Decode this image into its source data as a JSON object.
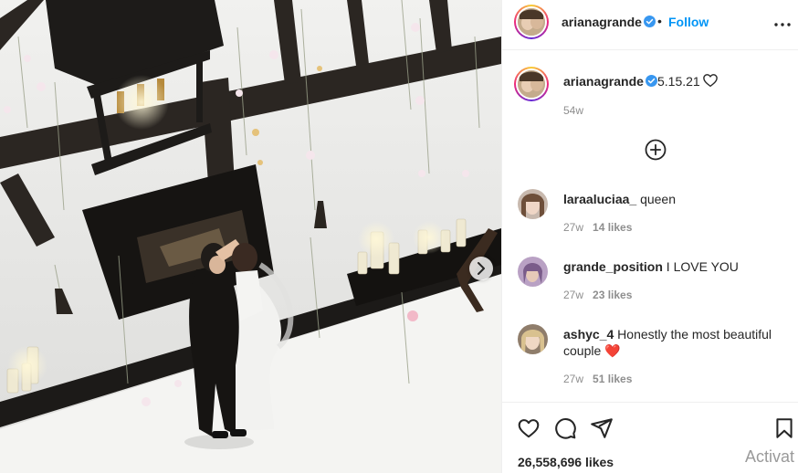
{
  "post": {
    "image_alt": "Couple dancing in a white room with hanging dried flowers, candles and a fireplace"
  },
  "header": {
    "username": "arianagrande",
    "separator": "•",
    "follow_label": "Follow"
  },
  "caption": {
    "username": "arianagrande",
    "text": "5.15.21",
    "time": "54w"
  },
  "comments": [
    {
      "username": "laraaluciaa_",
      "text": "queen",
      "time": "27w",
      "likes": "14 likes"
    },
    {
      "username": "grande_position",
      "text": "I LOVE YOU",
      "time": "27w",
      "likes": "23 likes"
    },
    {
      "username": "ashyc_4",
      "text": "Honestly the most beautiful couple",
      "emoji": "❤️",
      "time": "27w",
      "likes": "51 likes"
    }
  ],
  "footer": {
    "like_count": "26,558,696 likes",
    "watermark": "Activat"
  },
  "icons": {
    "verified": "verified-badge-icon",
    "more": "more-options-icon",
    "heart": "heart-icon",
    "add": "plus-circle-icon",
    "comment": "comment-icon",
    "share": "share-icon",
    "save": "bookmark-icon",
    "next": "chevron-right-icon"
  },
  "colors": {
    "follow_blue": "#0095f6",
    "verified_blue": "#3897f0",
    "muted_text": "#8e8e8e",
    "comment_heart": "#e0212f"
  }
}
